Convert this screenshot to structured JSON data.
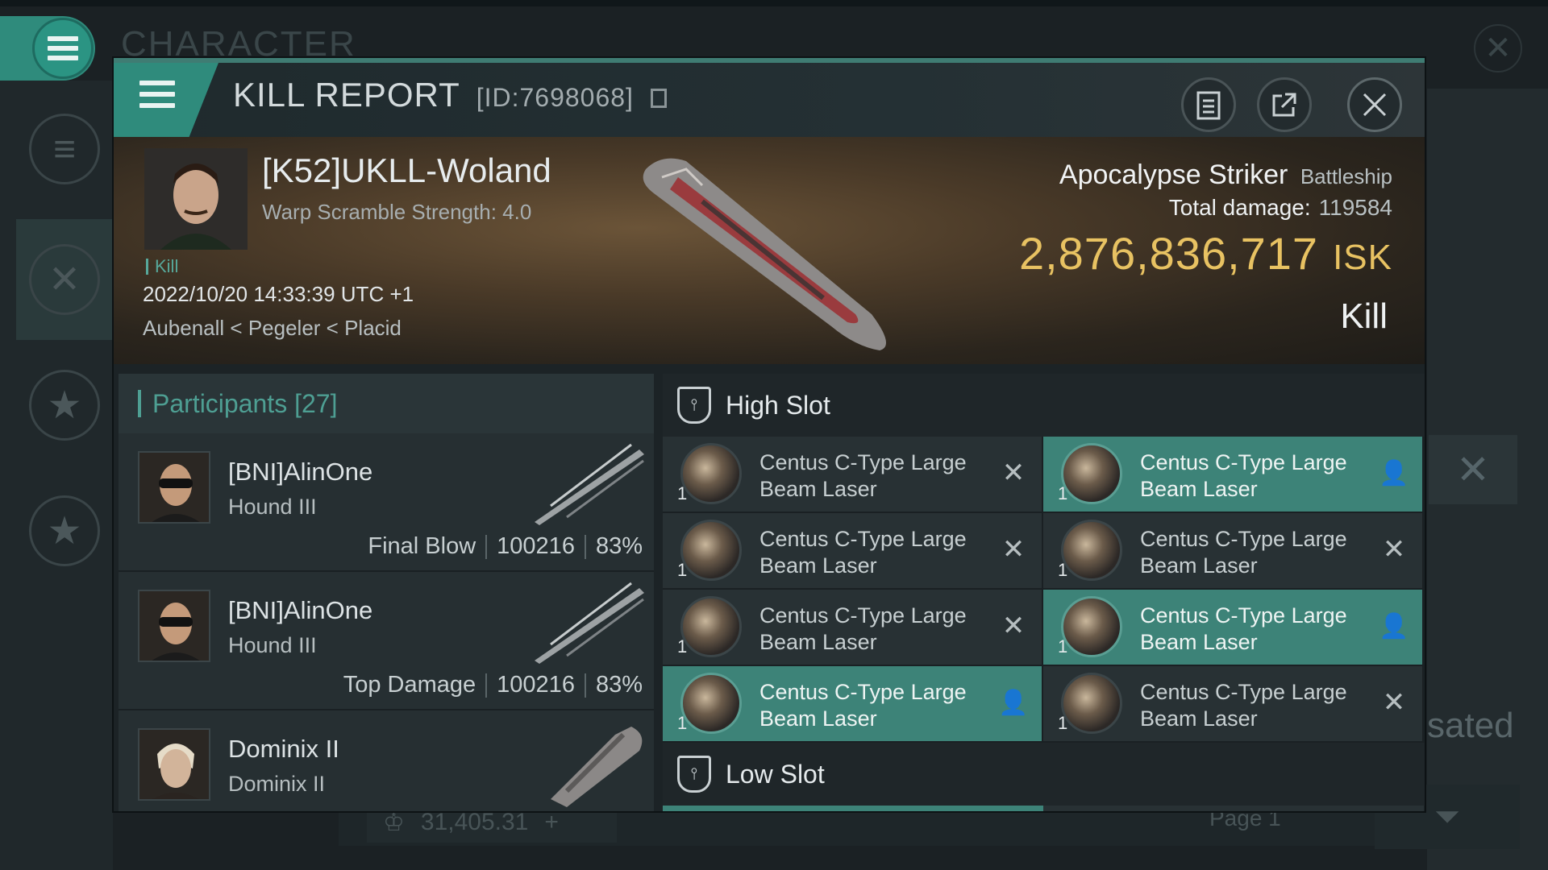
{
  "background": {
    "title": "CHARACTER",
    "partial_text": "sated",
    "balance": "31,405.31",
    "page": "Page 1"
  },
  "header": {
    "title": "KILL REPORT",
    "id_text": "[ID:7698068]"
  },
  "victim": {
    "pilot": "[K52]UKLL-Woland",
    "warp_scramble": "Warp Scramble Strength: 4.0",
    "tag": "Kill",
    "datetime": "2022/10/20 14:33:39 UTC +1",
    "location": "Aubenall < Pegeler < Placid",
    "ship": "Apocalypse Striker",
    "ship_class": "Battleship",
    "total_damage_label": "Total damage:",
    "total_damage": "119584",
    "isk_value": "2,876,836,717",
    "isk_unit": "ISK",
    "result": "Kill"
  },
  "participants": {
    "title": "Participants [27]",
    "rows": [
      {
        "name": "[BNI]AlinOne",
        "ship": "Hound III",
        "label": "Final Blow",
        "damage": "100216",
        "percent": "83%"
      },
      {
        "name": "[BNI]AlinOne",
        "ship": "Hound III",
        "label": "Top Damage",
        "damage": "100216",
        "percent": "83%"
      },
      {
        "name": "Dominix II",
        "ship": "Dominix II"
      }
    ]
  },
  "slots": {
    "high_title": "High Slot",
    "low_title": "Low Slot",
    "high_modules": [
      {
        "qty": "1",
        "name": "Centus C-Type Large Beam Laser",
        "state": "destroyed"
      },
      {
        "qty": "1",
        "name": "Centus C-Type Large Beam Laser",
        "state": "dropped"
      },
      {
        "qty": "1",
        "name": "Centus C-Type Large Beam Laser",
        "state": "destroyed"
      },
      {
        "qty": "1",
        "name": "Centus C-Type Large Beam Laser",
        "state": "destroyed"
      },
      {
        "qty": "1",
        "name": "Centus C-Type Large Beam Laser",
        "state": "destroyed"
      },
      {
        "qty": "1",
        "name": "Centus C-Type Large Beam Laser",
        "state": "dropped"
      },
      {
        "qty": "1",
        "name": "Centus C-Type Large Beam Laser",
        "state": "dropped"
      },
      {
        "qty": "1",
        "name": "Centus C-Type Large Beam Laser",
        "state": "destroyed"
      }
    ]
  },
  "colors": {
    "accent": "#3d8378",
    "isk": "#e8c262"
  }
}
